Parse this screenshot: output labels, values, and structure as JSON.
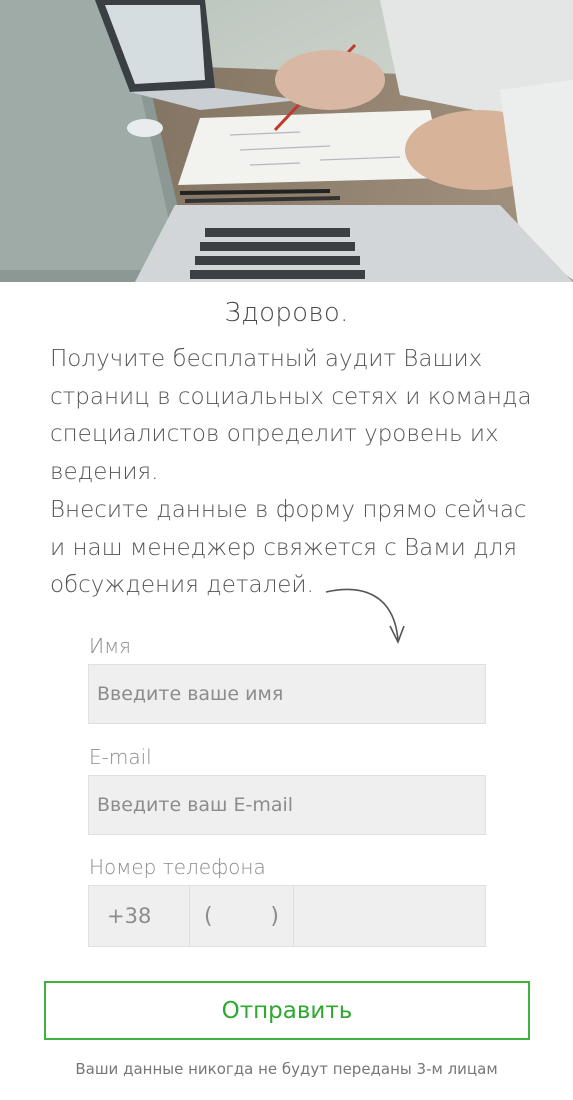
{
  "greeting": "Здорово.",
  "intro": {
    "paragraph1": "Получите бесплатный аудит Ваших страниц в социальных сетях и команда специалистов определит уровень их ведения.",
    "paragraph2": "Внесите данные в форму прямо сейчас и наш менеджер свяжется с Вами для обсуждения деталей."
  },
  "form": {
    "name": {
      "label": "Имя",
      "placeholder": "Введите ваше имя",
      "value": ""
    },
    "email": {
      "label": "E-mail",
      "placeholder": "Введите ваш E-mail",
      "value": ""
    },
    "phone": {
      "label": "Номер телефона",
      "country_code": "+38",
      "area_open": "(",
      "area_close": ")",
      "number_value": ""
    },
    "submit_label": "Отправить",
    "privacy_note": "Ваши данные никогда не будут переданы 3-м лицам"
  },
  "colors": {
    "accent_green": "#3db33d",
    "input_background": "#efefef",
    "text_gray": "#555555"
  },
  "icons": {
    "hero": "office-desk-laptops-photo",
    "pointer": "curved-arrow-down-icon"
  }
}
